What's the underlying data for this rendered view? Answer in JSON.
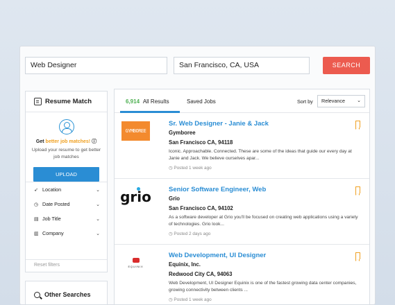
{
  "search": {
    "keyword": "Web Designer",
    "location": "San Francisco, CA, USA",
    "button": "SEARCH"
  },
  "resume_match": {
    "title": "Resume Match",
    "headline_prefix": "Get ",
    "headline_highlight": "better job matches!",
    "headline_suffix": " ⓘ",
    "description": "Upload your resume to get better job matches",
    "upload_button": "UPLOAD"
  },
  "filters": [
    {
      "icon": "location-arrow-icon",
      "glyph": "➶",
      "label": "Location"
    },
    {
      "icon": "clock-icon",
      "glyph": "◷",
      "label": "Date Posted"
    },
    {
      "icon": "id-card-icon",
      "glyph": "▤",
      "label": "Job Title"
    },
    {
      "icon": "building-icon",
      "glyph": "▥",
      "label": "Company"
    }
  ],
  "reset_filters": "Reset filters",
  "other_searches": "Other Searches",
  "results": {
    "count": "6,914",
    "all_label": "All Results",
    "saved_label": "Saved Jobs",
    "sort_label": "Sort by",
    "sort_value": "Relevance"
  },
  "jobs": [
    {
      "logo_text": "GYMBOREE",
      "title": "Sr. Web Designer - Janie & Jack",
      "company": "Gymboree",
      "location": "San Francisco CA, 94118",
      "description": "Iconic. Approachable. Connected. These are some of the ideas that guide our every day at Janie and Jack. We believe ourselves apar...",
      "posted": "Posted 1 week ago"
    },
    {
      "logo_text": "grio",
      "title": "Senior Software Engineer, Web",
      "company": "Grio",
      "location": "San Francisco CA, 94102",
      "description": "As a software developer at Grio you'll be focused on creating web applications using a variety of technologies. Grio look...",
      "posted": "Posted 2 days ago"
    },
    {
      "logo_text": "EQUINIX",
      "title": "Web Development, UI Designer",
      "company": "Equinix, Inc.",
      "location": "Redwood City CA, 94063",
      "description": "Web Development, UI Designer Equinix is one of the fastest growing data center companies, growing connectivity between clients ...",
      "posted": "Posted 1 week ago"
    }
  ],
  "colors": {
    "accent_blue": "#2a8dd4",
    "search_red": "#ec5b4f",
    "highlight_orange": "#f0a020",
    "count_green": "#4caf50"
  }
}
